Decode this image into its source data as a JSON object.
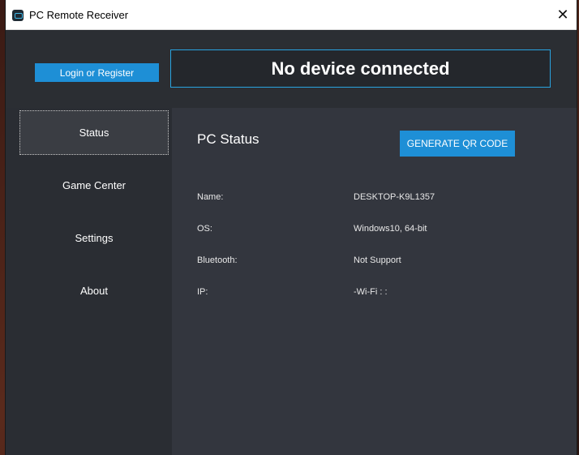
{
  "window": {
    "title": "PC Remote Receiver",
    "close_glyph": "✕"
  },
  "header": {
    "login_label": "Login or Register",
    "device_status": "No device connected"
  },
  "sidebar": {
    "items": [
      {
        "label": "Status",
        "active": true
      },
      {
        "label": "Game Center"
      },
      {
        "label": "Settings"
      },
      {
        "label": "About"
      }
    ]
  },
  "main": {
    "title": "PC Status",
    "qr_button": "GENERATE QR CODE",
    "rows": [
      {
        "label": "Name:",
        "value": "DESKTOP-K9L1357"
      },
      {
        "label": "OS:",
        "value": "Windows10, 64-bit"
      },
      {
        "label": "Bluetooth:",
        "value": "Not Support"
      },
      {
        "label": "IP:",
        "value": "-Wi-Fi : :"
      }
    ]
  },
  "colors": {
    "accent": "#1e8fd6",
    "border_accent": "#29a3e0",
    "background": "#2a2d33",
    "content_bg": "#33363e"
  }
}
